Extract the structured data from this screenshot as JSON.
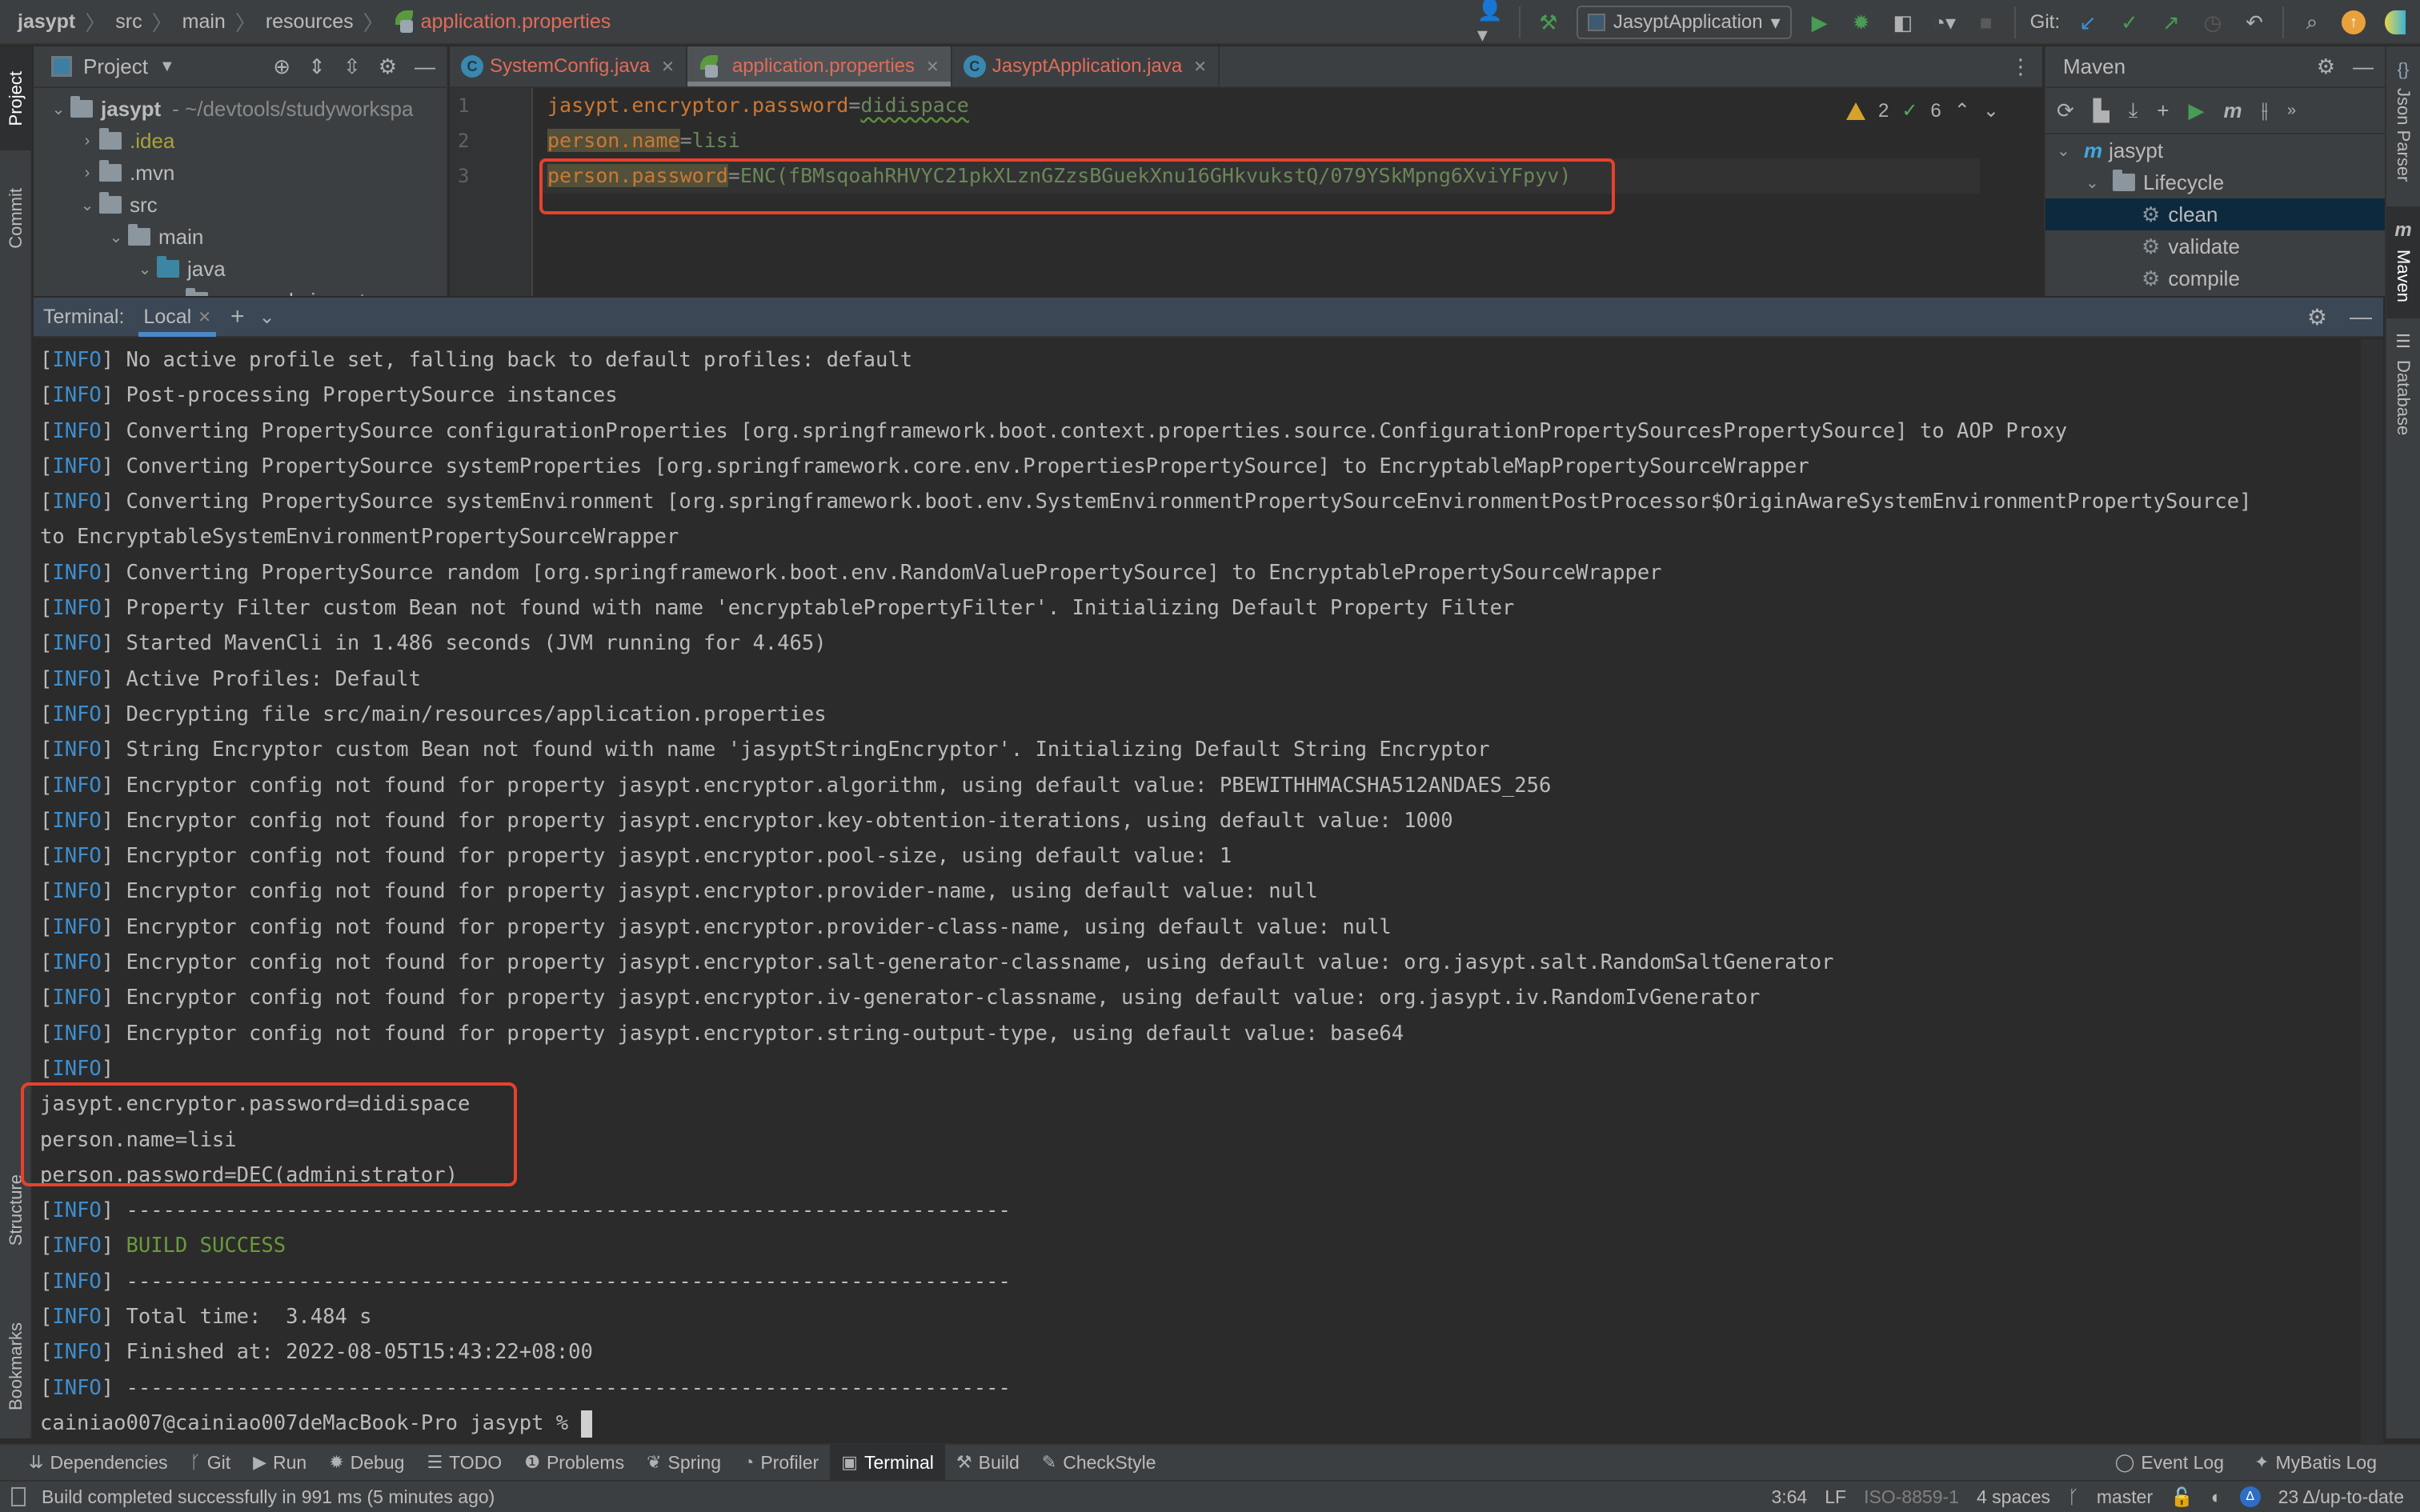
{
  "breadcrumb": {
    "items": [
      "jasypt",
      "src",
      "main",
      "resources"
    ],
    "file": "application.properties"
  },
  "toolbar": {
    "run_config": "JasyptApplication",
    "git_label": "Git:",
    "icons": [
      "user-icon",
      "hammer-icon",
      "run-icon",
      "debug-icon",
      "coverage-icon",
      "profile-icon",
      "stop-icon",
      "git-update-icon",
      "git-commit-icon",
      "git-push-icon",
      "history-icon",
      "rollback-icon",
      "search-icon",
      "update-icon",
      "toolbox-icon"
    ]
  },
  "left_strip": {
    "tabs": [
      "Project",
      "Commit",
      "Structure",
      "Bookmarks"
    ]
  },
  "right_strip": {
    "tabs": [
      "Json Parser",
      "Maven",
      "Database"
    ]
  },
  "project_panel": {
    "title": "Project",
    "tree": [
      {
        "name": "jasypt",
        "path": "- ~/devtools/studyworkspa",
        "expanded": true,
        "level": 0
      },
      {
        "name": ".idea",
        "expanded": false,
        "level": 1
      },
      {
        "name": ".mvn",
        "expanded": false,
        "level": 1
      },
      {
        "name": "src",
        "expanded": true,
        "level": 1
      },
      {
        "name": "main",
        "expanded": true,
        "level": 2
      },
      {
        "name": "java",
        "expanded": true,
        "level": 3
      },
      {
        "name": "com.csdn.jasypt",
        "expanded": true,
        "level": 4
      }
    ]
  },
  "editor": {
    "tabs": [
      {
        "label": "SystemConfig.java",
        "active": false
      },
      {
        "label": "application.properties",
        "active": true
      },
      {
        "label": "JasyptApplication.java",
        "active": false
      }
    ],
    "line_numbers": [
      "1",
      "2",
      "3"
    ],
    "lines": [
      {
        "key": "jasypt.encryptor.password",
        "eq": "=",
        "value": "didispace"
      },
      {
        "key": "person.name",
        "eq": "=",
        "value": "lisi"
      },
      {
        "key": "person.password",
        "eq": "=",
        "value": "ENC(fBMsqoahRHVYC21pkXLznGZzsBGuekXnu16GHkvukstQ/079YSkMpng6XviYFpyv)"
      }
    ],
    "inspections": {
      "warnings": "2",
      "typos": "6"
    }
  },
  "maven": {
    "title": "Maven",
    "tree": [
      {
        "label": "jasypt",
        "level": 0
      },
      {
        "label": "Lifecycle",
        "level": 1
      },
      {
        "label": "clean",
        "level": 2,
        "selected": true
      },
      {
        "label": "validate",
        "level": 2
      },
      {
        "label": "compile",
        "level": 2
      }
    ]
  },
  "terminal": {
    "title": "Terminal:",
    "tab": "Local",
    "info_tag": "INFO",
    "lines": [
      {
        "info": true,
        "text": " No active profile set, falling back to default profiles: default"
      },
      {
        "info": true,
        "text": " Post-processing PropertySource instances"
      },
      {
        "info": true,
        "text": " Converting PropertySource configurationProperties [org.springframework.boot.context.properties.source.ConfigurationPropertySourcesPropertySource] to AOP Proxy"
      },
      {
        "info": true,
        "text": " Converting PropertySource systemProperties [org.springframework.core.env.PropertiesPropertySource] to EncryptableMapPropertySourceWrapper"
      },
      {
        "info": true,
        "text": " Converting PropertySource systemEnvironment [org.springframework.boot.env.SystemEnvironmentPropertySourceEnvironmentPostProcessor$OriginAwareSystemEnvironmentPropertySource]"
      },
      {
        "info": false,
        "text": "to EncryptableSystemEnvironmentPropertySourceWrapper"
      },
      {
        "info": true,
        "text": " Converting PropertySource random [org.springframework.boot.env.RandomValuePropertySource] to EncryptablePropertySourceWrapper"
      },
      {
        "info": true,
        "text": " Property Filter custom Bean not found with name 'encryptablePropertyFilter'. Initializing Default Property Filter"
      },
      {
        "info": true,
        "text": " Started MavenCli in 1.486 seconds (JVM running for 4.465)"
      },
      {
        "info": true,
        "text": " Active Profiles: Default"
      },
      {
        "info": true,
        "text": " Decrypting file src/main/resources/application.properties"
      },
      {
        "info": true,
        "text": " String Encryptor custom Bean not found with name 'jasyptStringEncryptor'. Initializing Default String Encryptor"
      },
      {
        "info": true,
        "text": " Encryptor config not found for property jasypt.encryptor.algorithm, using default value: PBEWITHHMACSHA512ANDAES_256"
      },
      {
        "info": true,
        "text": " Encryptor config not found for property jasypt.encryptor.key-obtention-iterations, using default value: 1000"
      },
      {
        "info": true,
        "text": " Encryptor config not found for property jasypt.encryptor.pool-size, using default value: 1"
      },
      {
        "info": true,
        "text": " Encryptor config not found for property jasypt.encryptor.provider-name, using default value: null"
      },
      {
        "info": true,
        "text": " Encryptor config not found for property jasypt.encryptor.provider-class-name, using default value: null"
      },
      {
        "info": true,
        "text": " Encryptor config not found for property jasypt.encryptor.salt-generator-classname, using default value: org.jasypt.salt.RandomSaltGenerator"
      },
      {
        "info": true,
        "text": " Encryptor config not found for property jasypt.encryptor.iv-generator-classname, using default value: org.jasypt.iv.RandomIvGenerator"
      },
      {
        "info": true,
        "text": " Encryptor config not found for property jasypt.encryptor.string-output-type, using default value: base64"
      },
      {
        "info": true,
        "text": ""
      },
      {
        "info": false,
        "text": "jasypt.encryptor.password=didispace"
      },
      {
        "info": false,
        "text": "person.name=lisi"
      },
      {
        "info": false,
        "text": "person.password=DEC(administrator)"
      },
      {
        "info": true,
        "text": " ------------------------------------------------------------------------"
      },
      {
        "info": true,
        "text": " ",
        "success": "BUILD SUCCESS"
      },
      {
        "info": true,
        "text": " ------------------------------------------------------------------------"
      },
      {
        "info": true,
        "text": " Total time:  3.484 s"
      },
      {
        "info": true,
        "text": " Finished at: 2022-08-05T15:43:22+08:00"
      },
      {
        "info": true,
        "text": " ------------------------------------------------------------------------"
      }
    ],
    "prompt": "cainiao007@cainiao007deMacBook-Pro jasypt % "
  },
  "bottom_tabs": {
    "left": [
      {
        "label": "Dependencies",
        "icon": "dependencies-icon",
        "glyph": "⇊"
      },
      {
        "label": "Git",
        "icon": "git-branch-icon",
        "glyph": "ᚴ"
      },
      {
        "label": "Run",
        "icon": "run-icon",
        "glyph": "▶"
      },
      {
        "label": "Debug",
        "icon": "debug-icon",
        "glyph": "✹"
      },
      {
        "label": "TODO",
        "icon": "todo-icon",
        "glyph": "☰"
      },
      {
        "label": "Problems",
        "icon": "problems-icon",
        "glyph": "❶"
      },
      {
        "label": "Spring",
        "icon": "spring-icon",
        "glyph": "❦"
      },
      {
        "label": "Profiler",
        "icon": "profiler-icon",
        "glyph": "◔"
      },
      {
        "label": "Terminal",
        "icon": "terminal-icon",
        "glyph": "▣",
        "active": true
      },
      {
        "label": "Build",
        "icon": "build-icon",
        "glyph": "⚒"
      },
      {
        "label": "CheckStyle",
        "icon": "checkstyle-icon",
        "glyph": "✎"
      }
    ],
    "right": [
      {
        "label": "Event Log",
        "icon": "event-log-icon",
        "glyph": "◯"
      },
      {
        "label": "MyBatis Log",
        "icon": "mybatis-log-icon",
        "glyph": "✦"
      }
    ]
  },
  "statusbar": {
    "message": "Build completed successfully in 991 ms (5 minutes ago)",
    "position": "3:64",
    "line_sep": "LF",
    "encoding": "ISO-8859-1",
    "indent": "4 spaces",
    "branch": "master",
    "updates": "23 Δ/up-to-date"
  }
}
